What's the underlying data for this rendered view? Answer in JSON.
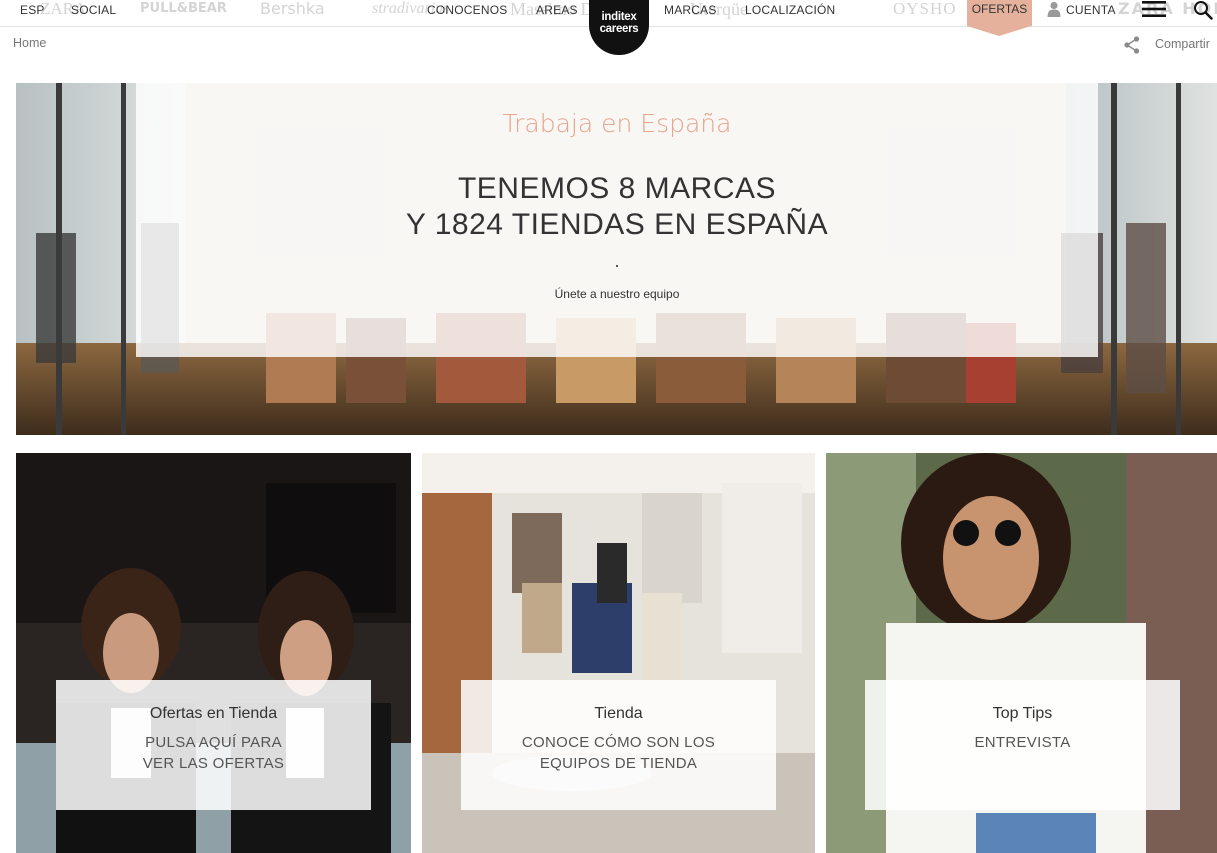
{
  "nav": {
    "lang": "ESP",
    "social": "SOCIAL",
    "conocenos": "CONOCENOS",
    "areas": "AREAS",
    "marcas": "MARCAS",
    "localizacion": "LOCALIZACIÓN",
    "ofertas": "OFERTAS",
    "cuenta": "CUENTA",
    "brands": [
      "ZARA",
      "PULL&BEAR",
      "Bershka",
      "stradivarius",
      "Massimo Dutti",
      "Uterqüe",
      "OYSHO",
      "ZARA HOME"
    ],
    "logo": {
      "line1": "inditex",
      "line2": "careers"
    },
    "accent_color": "#e6b19c"
  },
  "breadcrumb": "Home",
  "share": {
    "label": "Compartir",
    "icon": "share-icon"
  },
  "hero": {
    "kicker": "Trabaja en España",
    "title_line1": "TENEMOS 8 MARCAS",
    "title_line2": "Y 1824 TIENDAS EN ESPAÑA",
    "cta": "Únete a nuestro equipo",
    "kicker_color": "#e5a48e"
  },
  "cards": [
    {
      "title": "Ofertas en Tienda",
      "sub": [
        "PULSA AQUÍ PARA",
        "VER LAS OFERTAS"
      ]
    },
    {
      "title": "Tienda",
      "sub": [
        "CONOCE CÓMO SON LOS",
        "EQUIPOS DE TIENDA"
      ]
    },
    {
      "title": "Top Tips",
      "sub": [
        "ENTREVISTA",
        ""
      ]
    }
  ]
}
